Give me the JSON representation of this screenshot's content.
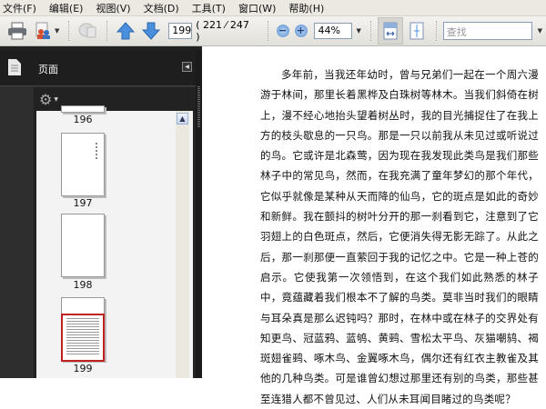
{
  "menubar": [
    "文件(F)",
    "编辑(E)",
    "视图(V)",
    "文档(D)",
    "工具(T)",
    "窗口(W)",
    "帮助(H)"
  ],
  "toolbar": {
    "page_value": "199",
    "page_count": "( 221 ⁄ 247 )",
    "zoom_value": "44%",
    "find_placeholder": "查找"
  },
  "sidebar": {
    "title": "页面",
    "thumbnails": [
      {
        "label": "196"
      },
      {
        "label": "197"
      },
      {
        "label": "198"
      },
      {
        "label": "199"
      }
    ]
  },
  "document": {
    "paragraph": "多年前，当我还年幼时，曾与兄弟们一起在一个周六漫游于林间，那里长着黑桦及白珠树等林木。当我们斜倚在树上，漫不经心地抬头望着树丛时，我的目光捕捉住了在我上方的枝头歇息的一只鸟。那是一只以前我从未见过或听说过的鸟。它或许是北森莺，因为现在我发现此类鸟是我们那些林子中的常见鸟，然而，在我充满了童年梦幻的那个年代，它似乎就像是某种从天而降的仙鸟，它的斑点是如此的奇妙和新鲜。我在颤抖的树叶分开的那一刹看到它，注意到了它羽翅上的白色斑点，然后，它便消失得无影无踪了。从此之后，那一刹那便一直萦回于我的记忆之中。它是一种上苍的启示。它使我第一次领悟到，在这个我们如此熟悉的林子中，竟蕴藏着我们根本不了解的鸟类。莫非当时我们的眼睛与耳朵真是那么迟钝吗？那时，在林中或在林子的交界处有知更鸟、冠蓝鸦、蓝鸲、黄鹀、雪松太平鸟、灰猫嘲鸫、褐斑翅雀鹀、啄木鸟、金翼啄木鸟，偶尔还有红衣主教雀及其他的几种鸟类。可是谁曾幻想过那里还有别的鸟类，那些甚至连猎人都不曾见过、人们从未耳闻目睹过的鸟类呢？"
  },
  "colors": {
    "selection": "#c0201f",
    "sidebar_bg": "#2e2e2e"
  }
}
